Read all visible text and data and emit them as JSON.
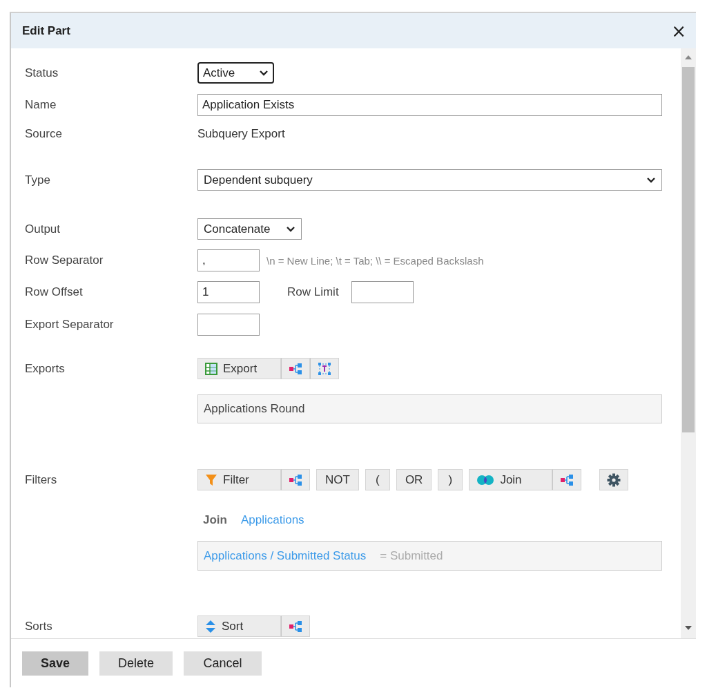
{
  "dialog": {
    "title": "Edit Part",
    "close_symbol": "×"
  },
  "status": {
    "label": "Status",
    "value": "Active",
    "focused": true
  },
  "name": {
    "label": "Name",
    "value": "Application Exists"
  },
  "source": {
    "label": "Source",
    "value": "Subquery Export"
  },
  "type": {
    "label": "Type",
    "value": "Dependent subquery"
  },
  "output": {
    "label": "Output",
    "value": "Concatenate"
  },
  "row_separator": {
    "label": "Row Separator",
    "value": ",",
    "hint": "\\n = New Line; \\t = Tab; \\\\ = Escaped Backslash"
  },
  "row_offset": {
    "label": "Row Offset",
    "value": "1"
  },
  "row_limit": {
    "label": "Row Limit"
  },
  "export_separator": {
    "label": "Export Separator"
  },
  "exports": {
    "label": "Exports",
    "toolbar": [
      [
        {
          "kind": "export",
          "label": "Export"
        },
        {
          "kind": "tree"
        },
        {
          "kind": "text-field"
        }
      ]
    ],
    "items": [
      "Applications Round"
    ]
  },
  "filters": {
    "label": "Filters",
    "toolbar": [
      [
        {
          "kind": "filter",
          "label": "Filter"
        },
        {
          "kind": "tree"
        }
      ],
      [
        {
          "kind": "operator",
          "label": "NOT"
        }
      ],
      [
        {
          "kind": "operator",
          "label": "("
        }
      ],
      [
        {
          "kind": "operator",
          "label": "OR"
        }
      ],
      [
        {
          "kind": "operator",
          "label": ")"
        }
      ],
      [
        {
          "kind": "join",
          "label": "Join"
        },
        {
          "kind": "tree"
        }
      ],
      [
        {
          "kind": "settings"
        }
      ]
    ],
    "join": {
      "label": "Join",
      "target": "Applications"
    },
    "conditions": [
      {
        "field": "Applications / Submitted Status",
        "value": "= Submitted"
      }
    ]
  },
  "sorts": {
    "label": "Sorts",
    "toolbar": [
      [
        {
          "kind": "sort",
          "label": "Sort"
        },
        {
          "kind": "tree"
        }
      ]
    ]
  },
  "buttons": [
    {
      "label": "Save",
      "primary": true
    },
    {
      "label": "Delete",
      "primary": false
    },
    {
      "label": "Cancel",
      "primary": false
    }
  ]
}
